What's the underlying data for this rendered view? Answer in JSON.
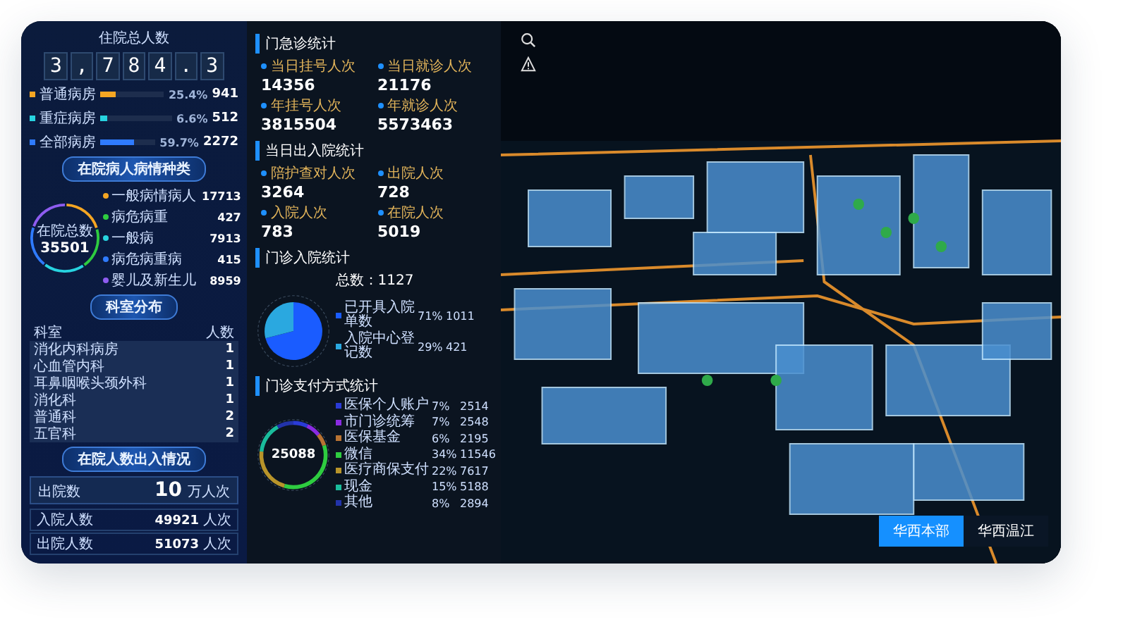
{
  "left_panel": {
    "counter": {
      "title": "住院总人数",
      "digits": [
        "3",
        ",",
        "7",
        "8",
        "4",
        ".",
        "3"
      ]
    },
    "bed_bars": [
      {
        "label": "普通病房",
        "level": 0.25,
        "percent": "25.4%",
        "value": "941",
        "color": "#f5a623"
      },
      {
        "label": "重症病房",
        "level": 0.1,
        "percent": "6.6%",
        "value": "512",
        "color": "#27d3e0"
      },
      {
        "label": "全部病房",
        "level": 0.6,
        "percent": "59.7%",
        "value": "2272",
        "color": "#2f7bff"
      }
    ],
    "condition": {
      "title": "在院病人病情种类",
      "center_label": "在院总数",
      "center_value": "35501",
      "legend": [
        {
          "label": "一般病情病人",
          "value": "17713",
          "color": "#f5a623"
        },
        {
          "label": "病危病重",
          "value": "427",
          "color": "#2ecc40"
        },
        {
          "label": "一般病",
          "value": "7913",
          "color": "#27d3e0"
        },
        {
          "label": "病危病重病",
          "value": "415",
          "color": "#2f7bff"
        },
        {
          "label": "婴儿及新生儿",
          "value": "8959",
          "color": "#8e5cf0"
        }
      ]
    },
    "departments": {
      "title": "科室分布",
      "columns": [
        "科室",
        "人数"
      ],
      "rows": [
        {
          "name": "消化内科病房",
          "count": "1"
        },
        {
          "name": "心血管内科",
          "count": "1"
        },
        {
          "name": "耳鼻咽喉头颈外科",
          "count": "1"
        },
        {
          "name": "消化科",
          "count": "1"
        },
        {
          "name": "普通科",
          "count": "2"
        },
        {
          "name": "五官科",
          "count": "2"
        }
      ]
    },
    "flow": {
      "title": "在院人数出入情况",
      "main_label": "出院数",
      "main_value": "10",
      "main_unit": "万人次",
      "stats": [
        {
          "label": "入院人数",
          "value": "49921",
          "unit": "人次"
        },
        {
          "label": "出院人数",
          "value": "51073",
          "unit": "人次"
        }
      ]
    }
  },
  "middle_panel": {
    "outpatient": {
      "title": "门急诊统计",
      "stats": [
        {
          "label": "当日挂号人次",
          "value": "14356"
        },
        {
          "label": "当日就诊人次",
          "value": "21176"
        },
        {
          "label": "年挂号人次",
          "value": "3815504"
        },
        {
          "label": "年就诊人次",
          "value": "5573463"
        }
      ]
    },
    "inpatient": {
      "title": "当日出入院统计",
      "stats": [
        {
          "label": "陪护查对人次",
          "value": "3264"
        },
        {
          "label": "出院人次",
          "value": "728"
        },
        {
          "label": "入院人次",
          "value": "783"
        },
        {
          "label": "在院人次",
          "value": "5019"
        }
      ]
    },
    "admission": {
      "title": "门诊入院统计",
      "total": "总数：1127",
      "chart_data": {
        "type": "pie",
        "categories": [
          "已开具入院单数",
          "入院中心登记数"
        ],
        "values": [
          71,
          29
        ]
      },
      "legend": [
        {
          "percent": "71%",
          "count": "1011",
          "color": "#1a5cff"
        },
        {
          "percent": "29%",
          "count": "421",
          "color": "#2aa8e0"
        }
      ]
    },
    "payment": {
      "title": "门诊支付方式统计",
      "center_value": "25088",
      "chart_data": {
        "type": "donut",
        "categories": [
          "医保个人账户",
          "市门诊统筹",
          "医保基金",
          "微信",
          "医疗商保支付",
          "现金",
          "其他"
        ],
        "values": [
          7,
          7,
          6,
          34,
          22,
          15,
          8
        ]
      },
      "legend": [
        {
          "percent": "7%",
          "count": "2514",
          "color": "#2a3bd6"
        },
        {
          "percent": "7%",
          "count": "2548",
          "color": "#8a2be2"
        },
        {
          "percent": "6%",
          "count": "2195",
          "color": "#b87333"
        },
        {
          "percent": "34%",
          "count": "11546",
          "color": "#2ecc40"
        },
        {
          "percent": "22%",
          "count": "7617",
          "color": "#b8942a"
        },
        {
          "percent": "15%",
          "count": "5188",
          "color": "#1abc9c"
        },
        {
          "percent": "8%",
          "count": "2894",
          "color": "#2233aa"
        }
      ]
    }
  },
  "scene": {
    "campus_tabs": [
      {
        "label": "华西本部",
        "selected": true
      },
      {
        "label": "华西温江",
        "selected": false
      }
    ]
  }
}
